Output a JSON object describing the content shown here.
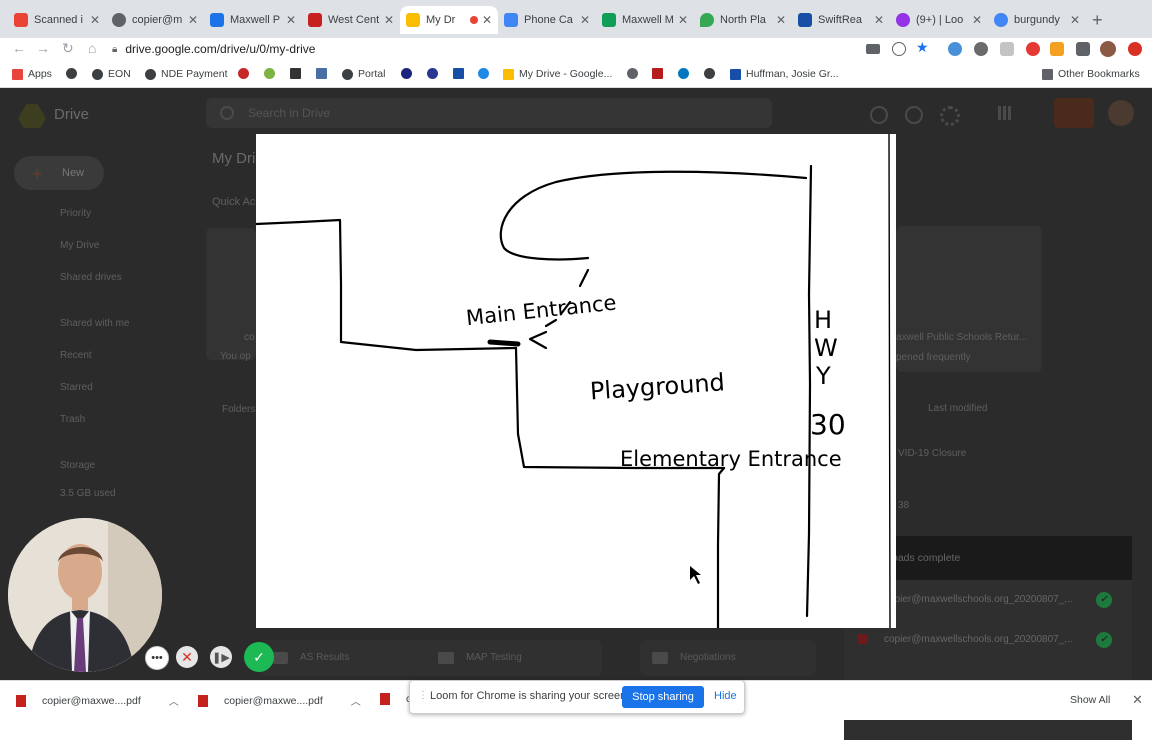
{
  "browser": {
    "tabs": [
      {
        "title": "Scanned i",
        "fav": "#ea4335"
      },
      {
        "title": "copier@m",
        "fav": "#5f6368"
      },
      {
        "title": "Maxwell P",
        "fav": "#1a73e8"
      },
      {
        "title": "West Cent",
        "fav": "#c5221f"
      },
      {
        "title": "My Dr",
        "fav": "#fbbc04"
      },
      {
        "title": "Phone Ca",
        "fav": "#4285f4"
      },
      {
        "title": "Maxwell M",
        "fav": "#0f9d58"
      },
      {
        "title": "North Pla",
        "fav": "#34a853"
      },
      {
        "title": "SwiftRea",
        "fav": "#174ea6"
      },
      {
        "title": "(9+) | Loo",
        "fav": "#9334e6"
      },
      {
        "title": "burgundy",
        "fav": "#4285f4"
      }
    ],
    "url": "drive.google.com/drive/u/0/my-drive",
    "bookmarks": [
      "Apps",
      "",
      "EON",
      "NDE Payment",
      "",
      "",
      "",
      "",
      "Portal",
      "",
      "",
      "",
      "",
      "",
      "My Drive - Google...",
      "",
      "",
      "",
      "",
      "Huffman, Josie Gr..."
    ],
    "other_bookmarks": "Other Bookmarks"
  },
  "drive": {
    "logo": "Drive",
    "search_placeholder": "Search in Drive",
    "new_label": "New",
    "nav": [
      "Priority",
      "My Drive",
      "Shared drives",
      "Shared with me",
      "Recent",
      "Starred",
      "Trash",
      "Storage"
    ],
    "storage_used": "3.5 GB used",
    "breadcrumb": "My Dri",
    "quick_access": "Quick Ac",
    "folders_heading": "Folders",
    "last_modified": "Last modified",
    "card_title": "axwell Public Schools Retur...",
    "card_sub": "pened frequently",
    "file_1": "VID-19 Closure",
    "file_2": "38",
    "folder_names": [
      "AS Results",
      "MAP Testing",
      "Negotiations"
    ],
    "uploads_title": "oads complete",
    "uploads": [
      "copier@maxwellschools.org_20200807_...",
      "copier@maxwellschools.org_20200807_..."
    ],
    "left_card_owner": "co",
    "left_card_sub": "You op"
  },
  "drawing": {
    "main_entrance": "Main Entrance",
    "playground": "Playground",
    "elementary_entrance": "Elementary Entrance",
    "hwy": [
      "H",
      "W",
      "Y"
    ],
    "hwy_number": "30"
  },
  "loom": {
    "sharing_message": "Loom for Chrome is sharing your screen.",
    "stop_sharing": "Stop sharing",
    "hide": "Hide"
  },
  "downloads": {
    "items": [
      "copier@maxwe....pdf",
      "copier@maxwe....pdf",
      "co"
    ],
    "show_all": "Show All"
  }
}
